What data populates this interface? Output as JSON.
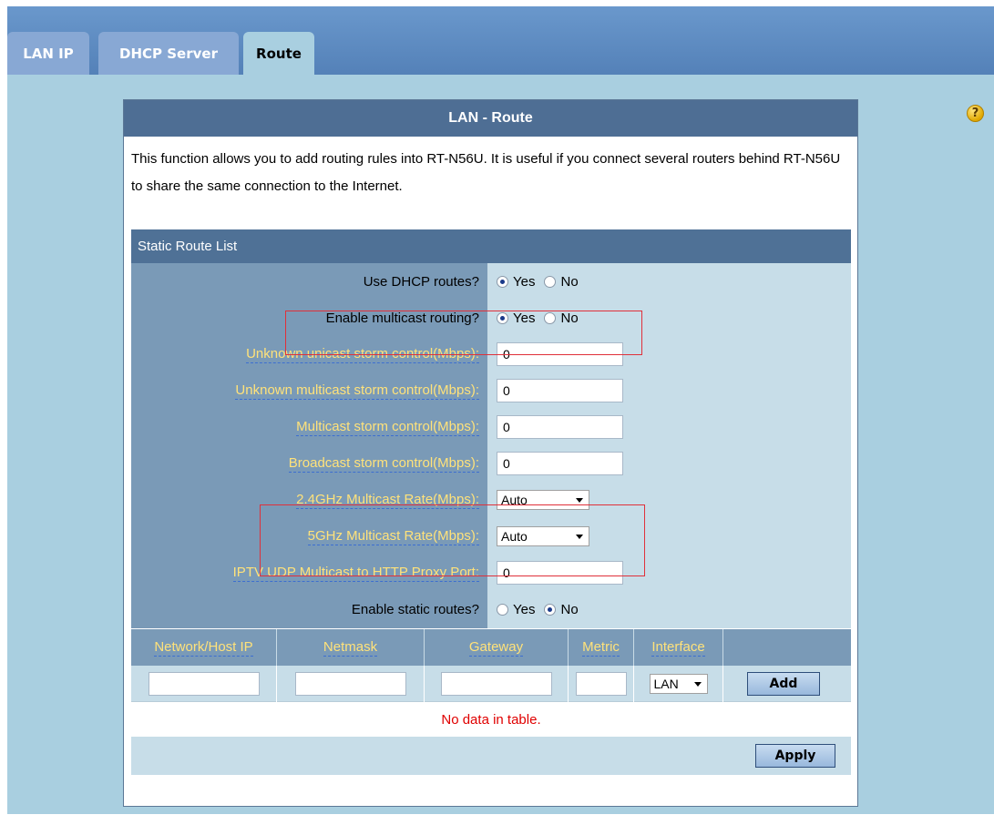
{
  "tabs": [
    {
      "label": "LAN IP"
    },
    {
      "label": "DHCP Server"
    },
    {
      "label": "Route"
    }
  ],
  "panel": {
    "title": "LAN - Route",
    "description": "This function allows you to add routing rules into RT-N56U. It is useful if you connect several routers behind RT-N56U to share the same connection to the Internet."
  },
  "static_route_list": {
    "header": "Static Route List",
    "fields": {
      "use_dhcp_routes": {
        "label": "Use DHCP routes?",
        "options": [
          "Yes",
          "No"
        ],
        "selected": "Yes"
      },
      "enable_multicast_routing": {
        "label": "Enable multicast routing?",
        "options": [
          "Yes",
          "No"
        ],
        "selected": "Yes"
      },
      "unknown_unicast": {
        "label": "Unknown unicast storm control(Mbps):",
        "value": "0"
      },
      "unknown_multicast": {
        "label": "Unknown multicast storm control(Mbps):",
        "value": "0"
      },
      "multicast_storm": {
        "label": "Multicast storm control(Mbps):",
        "value": "0"
      },
      "broadcast_storm": {
        "label": "Broadcast storm control(Mbps):",
        "value": "0"
      },
      "rate_24": {
        "label": "2.4GHz Multicast Rate(Mbps):",
        "value": "Auto"
      },
      "rate_5": {
        "label": "5GHz Multicast Rate(Mbps):",
        "value": "Auto"
      },
      "iptv_port": {
        "label": "IPTV UDP Multicast to HTTP Proxy Port:",
        "value": "0"
      },
      "enable_static_routes": {
        "label": "Enable static routes?",
        "options": [
          "Yes",
          "No"
        ],
        "selected": "No"
      }
    },
    "columns": [
      "Network/Host IP",
      "Netmask",
      "Gateway",
      "Metric",
      "Interface"
    ],
    "interface_value": "LAN",
    "add_label": "Add",
    "empty_text": "No data in table.",
    "apply_label": "Apply"
  },
  "help_icon": {
    "glyph": "?"
  },
  "colors": {
    "header": "#4e6e94",
    "label_bg": "#7a9ab7",
    "value_bg": "#c7dde8",
    "link": "#ffe27a",
    "highlight": "#e0303a"
  }
}
